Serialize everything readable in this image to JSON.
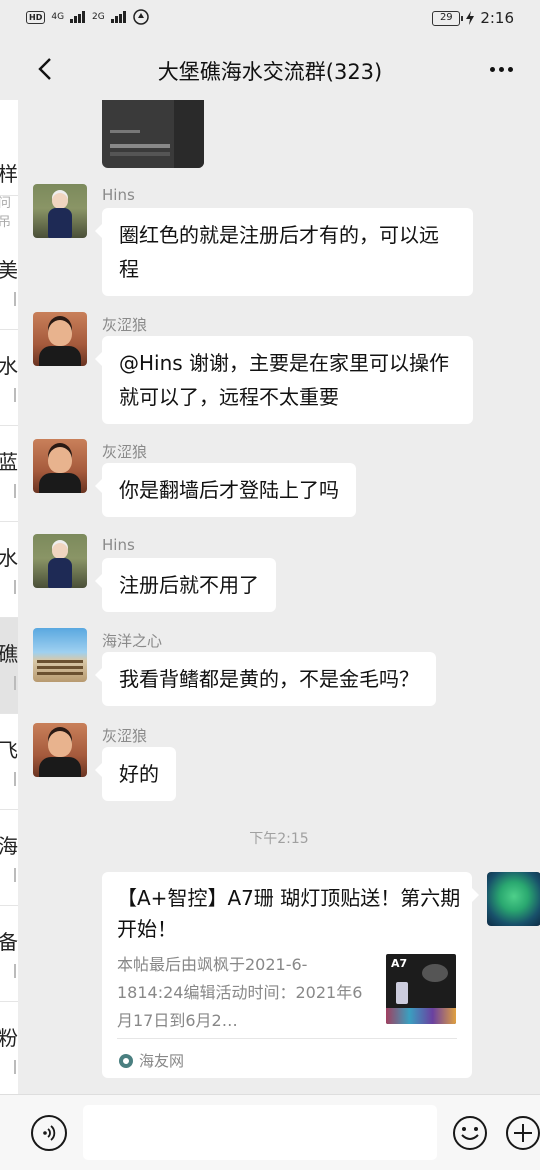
{
  "status_bar": {
    "network_1": "4G",
    "network_2": "2G",
    "battery": "29",
    "time": "2:16"
  },
  "nav": {
    "title": "大堡礁海水交流群(323)"
  },
  "peek_list": [
    {
      "char": "样",
      "sub": "问吊"
    },
    {
      "char": "美",
      "sub": ""
    },
    {
      "char": "水",
      "sub": ""
    },
    {
      "char": "蓝",
      "sub": ""
    },
    {
      "char": "水",
      "sub": ""
    },
    {
      "char": "礁",
      "sub": ""
    },
    {
      "char": "飞",
      "sub": ""
    },
    {
      "char": "海",
      "sub": ""
    },
    {
      "char": "备",
      "sub": ""
    },
    {
      "char": "粉",
      "sub": ""
    }
  ],
  "messages": [
    {
      "sender": "Hins",
      "text": "圈红色的就是注册后才有的，可以远程"
    },
    {
      "sender": "灰涩狼",
      "text": "@Hins  谢谢，主要是在家里可以操作就可以了，远程不太重要"
    },
    {
      "sender": "灰涩狼",
      "text": "你是翻墙后才登陆上了吗"
    },
    {
      "sender": "Hins",
      "text": "注册后就不用了"
    },
    {
      "sender": "海洋之心",
      "text": "我看背鳍都是黄的，不是金毛吗？"
    },
    {
      "sender": "灰涩狼",
      "text": "好的"
    }
  ],
  "timestamp": "下午2:15",
  "link_card": {
    "title": "【A+智控】A7珊 瑚灯顶贴送！第六期开始！",
    "description": "本帖最后由飒枫于2021-6-1814:24编辑活动时间：2021年6月17日到6月2…",
    "thumb_label": "A7",
    "source": "海友网"
  },
  "input": {
    "placeholder": ""
  }
}
